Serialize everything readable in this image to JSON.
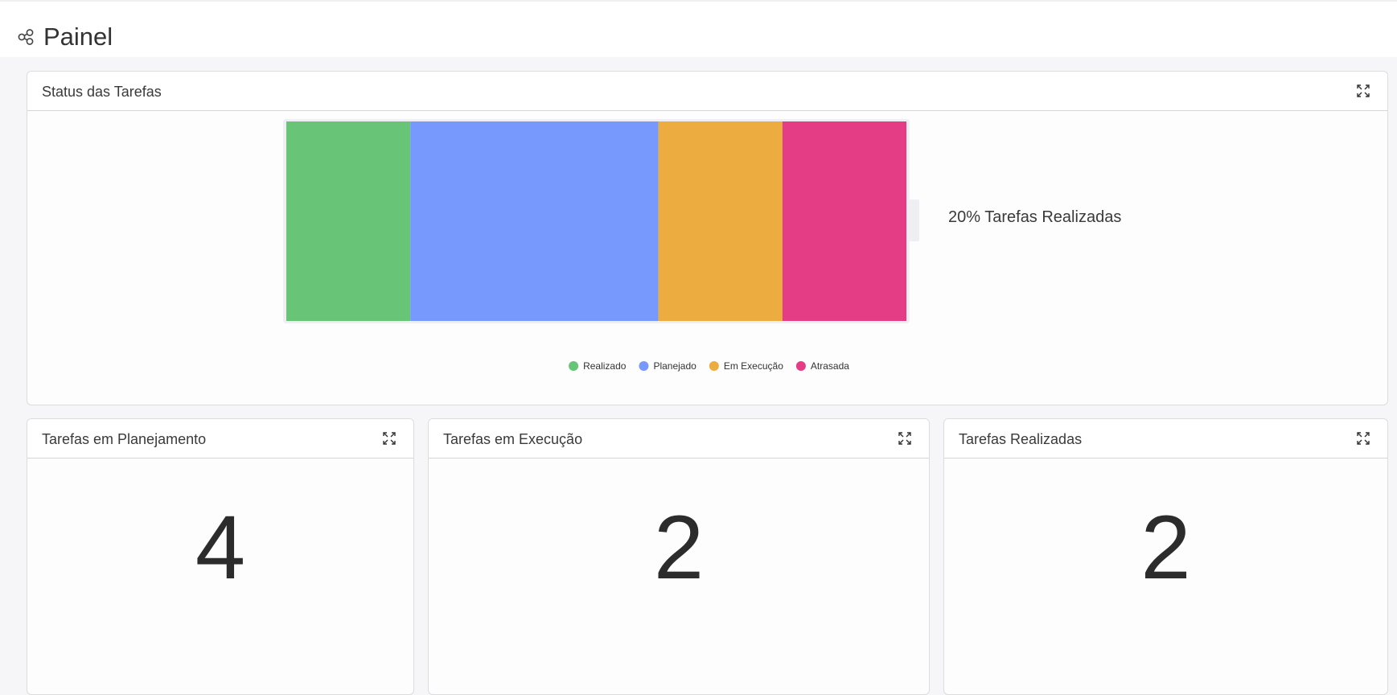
{
  "page": {
    "title": "Painel",
    "icon": "share-nodes-icon"
  },
  "status_card": {
    "title": "Status das Tarefas",
    "expand_icon": "expand-icon",
    "battery_label": "20% Tarefas Realizadas"
  },
  "chart_data": {
    "type": "bar",
    "orientation": "stacked-horizontal",
    "categories": [
      "Realizado",
      "Planejado",
      "Em Execução",
      "Atrasada"
    ],
    "values": [
      2,
      4,
      2,
      2
    ],
    "colors": [
      "#68c477",
      "#7799fd",
      "#ecac3f",
      "#e43d86"
    ],
    "legend_placement": "bottom",
    "grid": false
  },
  "cards": {
    "planning": {
      "title": "Tarefas em Planejamento",
      "value": "4"
    },
    "execution": {
      "title": "Tarefas em Execução",
      "value": "2"
    },
    "done": {
      "title": "Tarefas Realizadas",
      "value": "2"
    }
  }
}
